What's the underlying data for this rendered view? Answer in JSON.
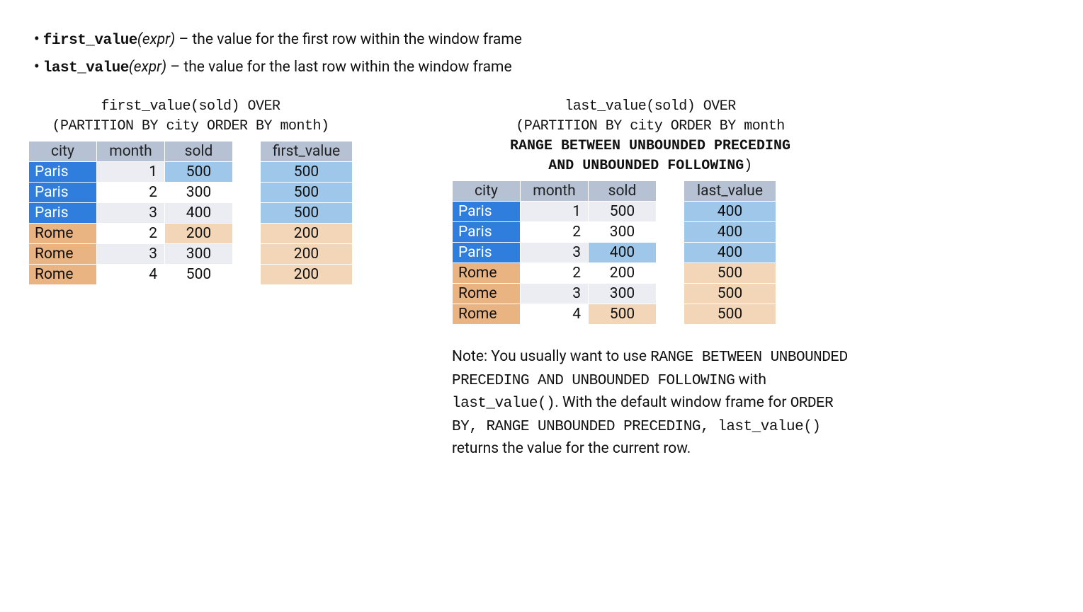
{
  "defs": [
    {
      "name": "first_value",
      "arg": "(expr)",
      "desc": " – the value for the first row within the window frame"
    },
    {
      "name": "last_value",
      "arg": "(expr)",
      "desc": " – the value for the last row within the window frame"
    }
  ],
  "left": {
    "caption_l1": "first_value(sold) OVER",
    "caption_l2": "(PARTITION BY city ORDER BY month)",
    "headers": {
      "city": "city",
      "month": "month",
      "sold": "sold",
      "value": "first_value"
    },
    "rows": [
      {
        "city": "Paris",
        "month": "1",
        "sold": "500",
        "val": "500",
        "group": "paris",
        "hi_sold": true
      },
      {
        "city": "Paris",
        "month": "2",
        "sold": "300",
        "val": "500",
        "group": "paris",
        "hi_sold": false
      },
      {
        "city": "Paris",
        "month": "3",
        "sold": "400",
        "val": "500",
        "group": "paris",
        "hi_sold": false
      },
      {
        "city": "Rome",
        "month": "2",
        "sold": "200",
        "val": "200",
        "group": "rome",
        "hi_sold": true
      },
      {
        "city": "Rome",
        "month": "3",
        "sold": "300",
        "val": "200",
        "group": "rome",
        "hi_sold": false
      },
      {
        "city": "Rome",
        "month": "4",
        "sold": "500",
        "val": "200",
        "group": "rome",
        "hi_sold": false
      }
    ]
  },
  "right": {
    "caption_l1": "last_value(sold) OVER",
    "caption_l2": "(PARTITION BY city ORDER BY month",
    "caption_l3": "RANGE BETWEEN UNBOUNDED PRECEDING",
    "caption_l4a": "AND UNBOUNDED FOLLOWING",
    "caption_l4b": ")",
    "headers": {
      "city": "city",
      "month": "month",
      "sold": "sold",
      "value": "last_value"
    },
    "rows": [
      {
        "city": "Paris",
        "month": "1",
        "sold": "500",
        "val": "400",
        "group": "paris",
        "hi_sold": false
      },
      {
        "city": "Paris",
        "month": "2",
        "sold": "300",
        "val": "400",
        "group": "paris",
        "hi_sold": false
      },
      {
        "city": "Paris",
        "month": "3",
        "sold": "400",
        "val": "400",
        "group": "paris",
        "hi_sold": true
      },
      {
        "city": "Rome",
        "month": "2",
        "sold": "200",
        "val": "500",
        "group": "rome",
        "hi_sold": false
      },
      {
        "city": "Rome",
        "month": "3",
        "sold": "300",
        "val": "500",
        "group": "rome",
        "hi_sold": false
      },
      {
        "city": "Rome",
        "month": "4",
        "sold": "500",
        "val": "500",
        "group": "rome",
        "hi_sold": true
      }
    ]
  },
  "note": {
    "p1a": "Note: You usually want to use ",
    "p1b": "RANGE BETWEEN UNBOUNDED PRECEDING AND UNBOUNDED FOLLOWING",
    "p1c": " with ",
    "p1d": "last_value()",
    "p1e": ". With the default window frame for ",
    "p1f": "ORDER BY",
    "p1g": ", ",
    "p1h": "RANGE UNBOUNDED PRECEDING",
    "p1i": ", ",
    "p1j": "last_value()",
    "p1k": " returns the value for the current row."
  }
}
